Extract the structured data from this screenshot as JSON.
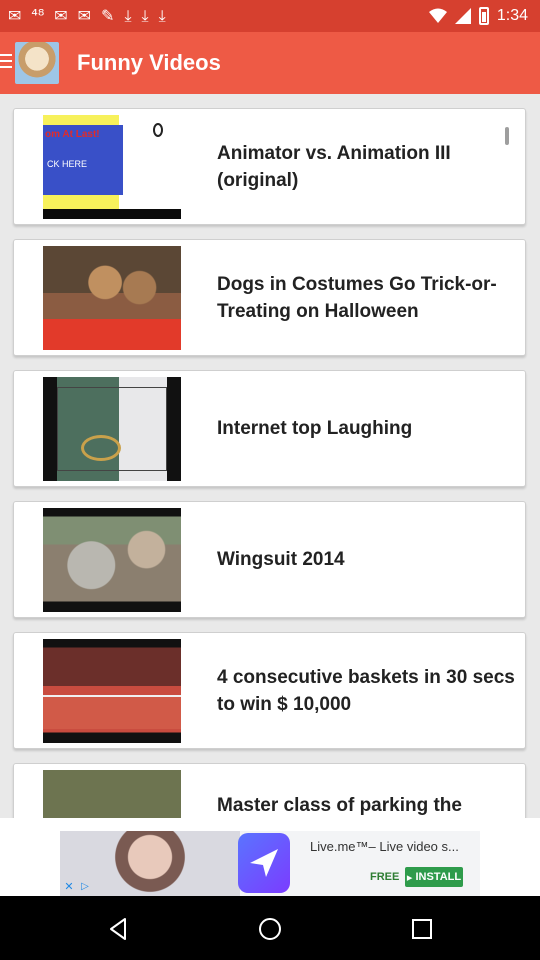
{
  "status_bar": {
    "time": "1:34",
    "icons": [
      "gmail-icon",
      "48-icon",
      "gmail-icon",
      "gmail-icon",
      "wrench-icon",
      "download-icon",
      "download-icon",
      "download-icon"
    ],
    "icon_glyphs": [
      "✉",
      "⁴⁸",
      "✉",
      "✉",
      "✎",
      "⤓",
      "⤓",
      "⤓"
    ]
  },
  "app_bar": {
    "title": "Funny Videos"
  },
  "videos": [
    {
      "title": "Animator vs. Animation III (original)",
      "thumb_caption": "om At Last!",
      "thumb_caption2": "CK HERE"
    },
    {
      "title": "Dogs in Costumes Go Trick-or-Treating on Halloween"
    },
    {
      "title": "Internet top Laughing"
    },
    {
      "title": "Wingsuit 2014"
    },
    {
      "title": "4 consecutive baskets in 30 secs to win $ 10,000"
    },
    {
      "title": "Master class of parking the"
    }
  ],
  "ad": {
    "headline": "Live.me™– Live video s...",
    "free_label": "FREE",
    "install_label": "INSTALL"
  },
  "colors": {
    "status_bar": "#d6402f",
    "app_bar": "#ee5a45",
    "list_bg": "#e9e9e9",
    "install_green": "#2e9b4b"
  }
}
